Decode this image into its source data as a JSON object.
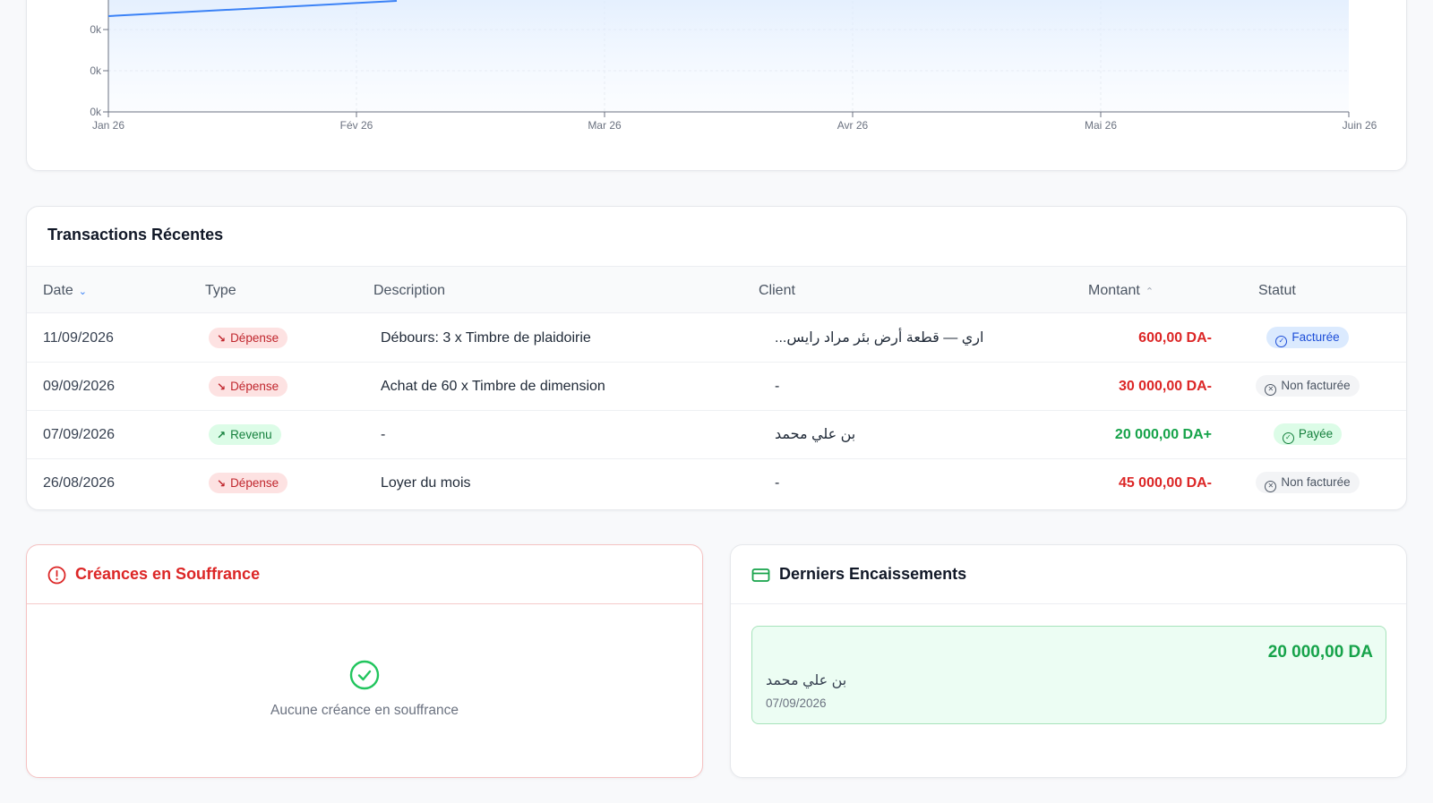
{
  "chart_data": {
    "type": "area",
    "x": [
      "Jan 26",
      "Fév 26",
      "Mar 26",
      "Avr 26",
      "Mai 26",
      "Juin 26"
    ],
    "y_tick_labels": [
      "0k",
      "0k",
      "0k"
    ],
    "grid": true,
    "line_color": "#3b82f6",
    "fill_color": "#dbeafe",
    "visible_segment_note": "line rises from Jan 26 toward Fév 26 (top cropped)"
  },
  "transactions": {
    "title": "Transactions Récentes",
    "headers": {
      "date": "Date",
      "type": "Type",
      "description": "Description",
      "client": "Client",
      "amount": "Montant",
      "status": "Statut"
    },
    "rows": [
      {
        "date": "11/09/2026",
        "type": "Dépense",
        "type_kind": "exp",
        "description": "Débours: 3 x Timbre de plaidoirie",
        "client": "...اري — قطعة أرض بئر مراد رايس",
        "amount": "600,00 DA-",
        "amount_kind": "neg",
        "status": "Facturée",
        "status_kind": "st-facturee"
      },
      {
        "date": "09/09/2026",
        "type": "Dépense",
        "type_kind": "exp",
        "description": "Achat de 60 x Timbre de dimension",
        "client": "-",
        "amount": "30 000,00 DA-",
        "amount_kind": "neg",
        "status": "Non facturée",
        "status_kind": "st-non"
      },
      {
        "date": "07/09/2026",
        "type": "Revenu",
        "type_kind": "inc",
        "description": "-",
        "client": "بن علي محمد",
        "amount": "20 000,00 DA+",
        "amount_kind": "pos",
        "status": "Payée",
        "status_kind": "st-payee"
      },
      {
        "date": "26/08/2026",
        "type": "Dépense",
        "type_kind": "exp",
        "description": "Loyer du mois",
        "client": "-",
        "amount": "45 000,00 DA-",
        "amount_kind": "neg",
        "status": "Non facturée",
        "status_kind": "st-non"
      }
    ]
  },
  "creances": {
    "title": "Créances en Souffrance",
    "empty_text": "Aucune créance en souffrance",
    "icon": "alert-circle-icon"
  },
  "encaissements": {
    "title": "Derniers Encaissements",
    "icon": "credit-card-icon",
    "items": [
      {
        "amount": "20 000,00 DA",
        "client": "بن علي محمد",
        "date": "07/09/2026"
      }
    ]
  },
  "colors": {
    "expense": "#dc2626",
    "income": "#16a34a",
    "accent": "#3b82f6"
  }
}
